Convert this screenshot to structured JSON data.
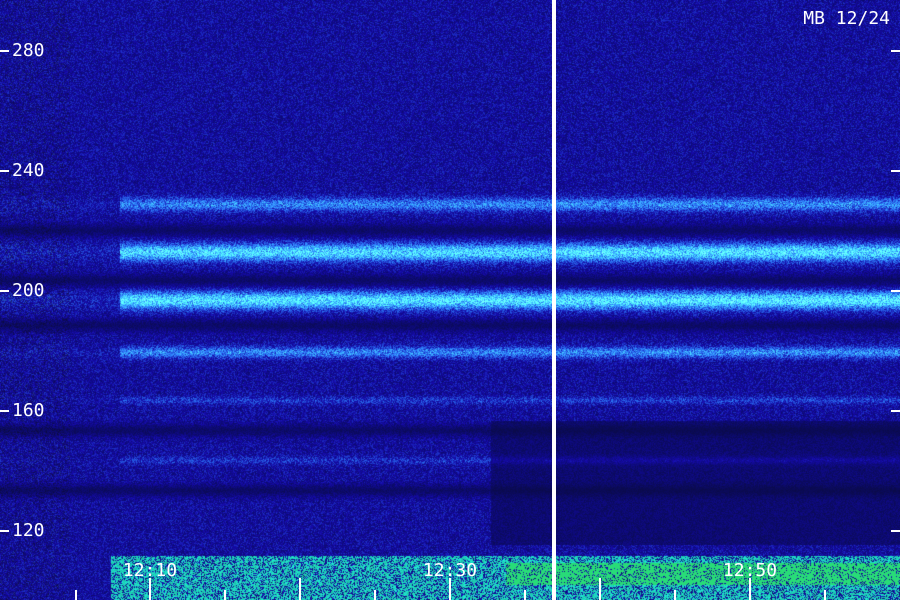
{
  "header": {
    "stamp": "MB 12/24"
  },
  "y_axis": {
    "labels": [
      "280",
      "240",
      "200",
      "160",
      "120"
    ]
  },
  "x_axis": {
    "labels": [
      "12:10",
      "12:30",
      "12:50"
    ]
  },
  "colors": {
    "background": "#0a0a6e",
    "band": "#2f7bff",
    "band_bright": "#40c8ff",
    "noise_green": "#29e08a",
    "marks": "#ffffff"
  }
}
